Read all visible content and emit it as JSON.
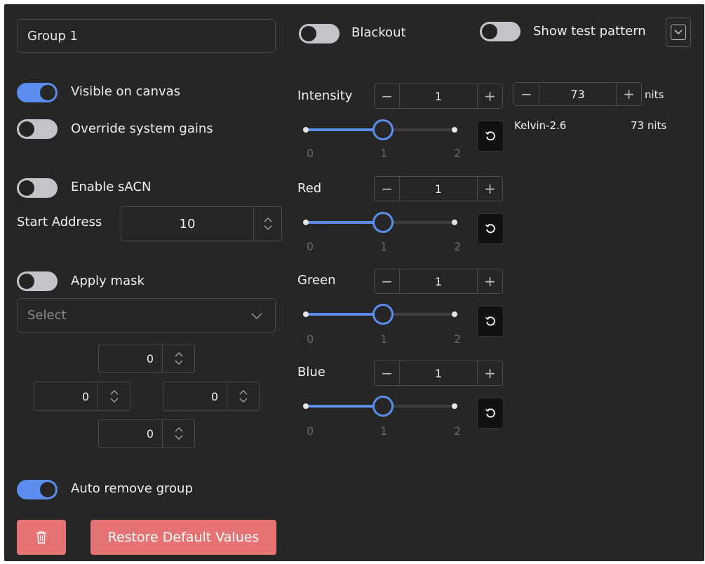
{
  "group": {
    "name": "Group 1"
  },
  "header": {
    "blackout_label": "Blackout",
    "test_pattern_label": "Show test pattern"
  },
  "toggles": {
    "visible_on_canvas": {
      "label": "Visible on canvas",
      "on": true
    },
    "override_system_gains": {
      "label": "Override system gains",
      "on": false
    },
    "enable_sacn": {
      "label": "Enable sACN",
      "on": false
    },
    "apply_mask": {
      "label": "Apply mask",
      "on": false
    },
    "auto_remove_group": {
      "label": "Auto remove group",
      "on": true
    },
    "blackout": {
      "on": false
    },
    "show_test_pattern": {
      "on": false
    }
  },
  "sacn": {
    "start_address_label": "Start Address",
    "start_address": "10"
  },
  "mask": {
    "select_placeholder": "Select",
    "top": "0",
    "left": "0",
    "right": "0",
    "bottom": "0"
  },
  "sliders": {
    "intensity": {
      "label": "Intensity",
      "value": "1",
      "min_label": "0",
      "mid_label": "1",
      "max_label": "2"
    },
    "red": {
      "label": "Red",
      "value": "1",
      "min_label": "0",
      "mid_label": "1",
      "max_label": "2"
    },
    "green": {
      "label": "Green",
      "value": "1",
      "min_label": "0",
      "mid_label": "1",
      "max_label": "2"
    },
    "blue": {
      "label": "Blue",
      "value": "1",
      "min_label": "0",
      "mid_label": "1",
      "max_label": "2"
    }
  },
  "nits": {
    "value": "73",
    "unit": "nits",
    "preset_name": "Kelvin-2.6",
    "preset_value": "73 nits"
  },
  "buttons": {
    "minus": "−",
    "plus": "+",
    "restore_defaults": "Restore Default Values"
  },
  "colors": {
    "accent": "#5b8def",
    "danger": "#e57373",
    "panel": "#262626"
  },
  "icons": {
    "reset": "rotate-ccw-icon",
    "trash": "trash-icon",
    "chevron": "chevron-down-icon"
  }
}
